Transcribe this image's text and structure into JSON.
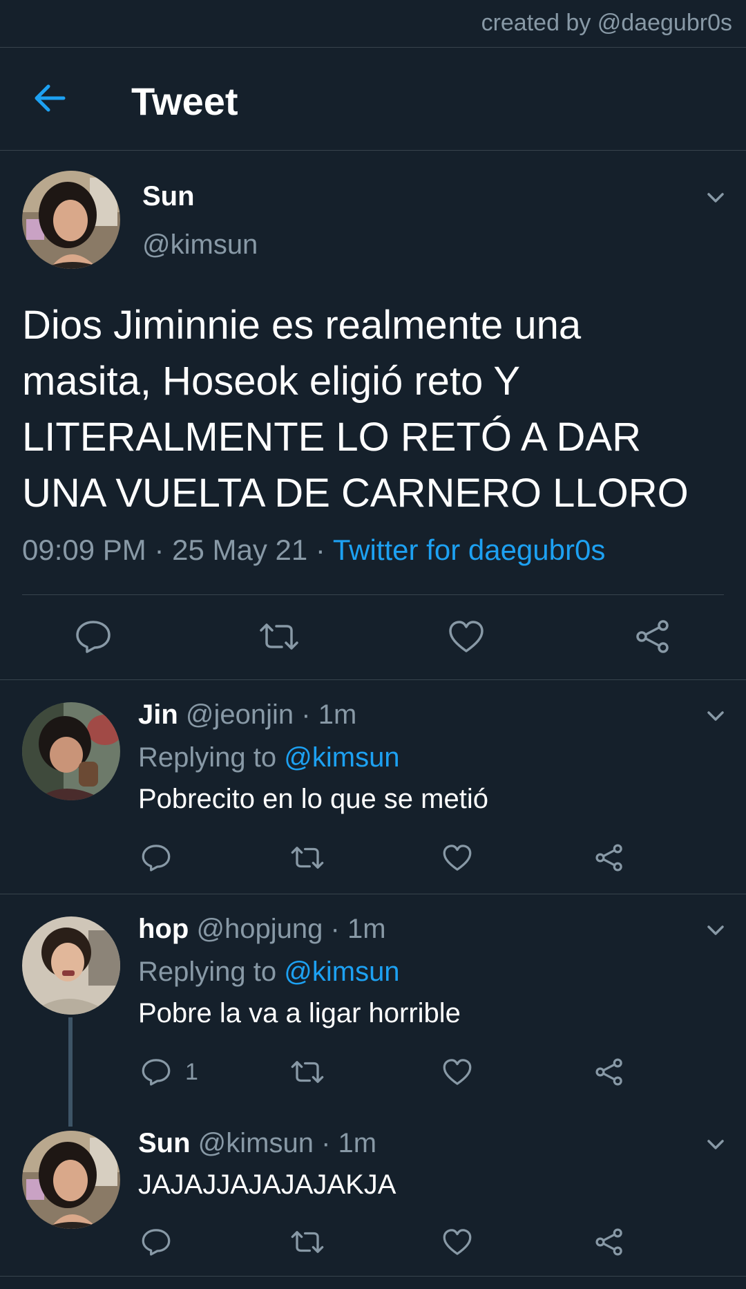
{
  "watermark": "created by @daegubr0s",
  "header": {
    "title": "Tweet",
    "back_icon": "arrow-left-icon"
  },
  "colors": {
    "background": "#15202b",
    "accent": "#1da1f2",
    "muted": "#8899a6",
    "divider": "#38444d"
  },
  "main_tweet": {
    "name": "Sun",
    "handle": "@kimsun",
    "text": "Dios Jiminnie es realmente una masita,  Hoseok eligió reto Y LITERALMENTE LO RETÓ A DAR UNA VUELTA DE CARNERO LLORO",
    "time": "09:09 PM",
    "sep1": " · ",
    "date": "25 May 21",
    "sep2": " · ",
    "source": "Twitter for daegubr0s"
  },
  "replies": [
    {
      "name": "Jin",
      "handle": "@jeonjin",
      "time": "· 1m",
      "replying_label": "Replying to",
      "replying_to": "@kimsun",
      "text": "Pobrecito en lo que se metió",
      "reply_count": ""
    },
    {
      "name": "hop",
      "handle": "@hopjung",
      "time": "· 1m",
      "replying_label": "Replying to",
      "replying_to": "@kimsun",
      "text": "Pobre la va a ligar horrible",
      "reply_count": "1"
    },
    {
      "name": "Sun",
      "handle": "@kimsun",
      "time": "· 1m",
      "text": "JAJAJJAJAJAJAKJA",
      "reply_count": ""
    }
  ]
}
